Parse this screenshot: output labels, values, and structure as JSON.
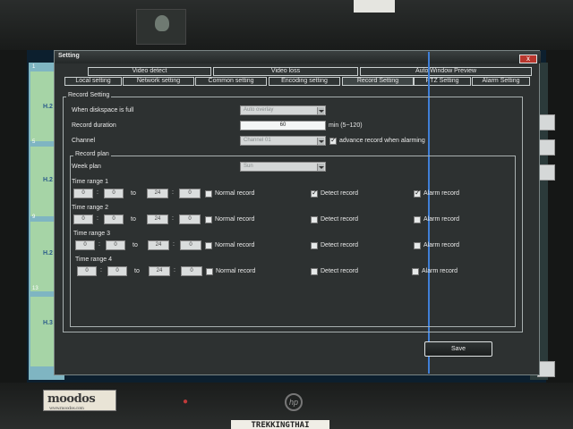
{
  "window": {
    "title": "Setting",
    "close_label": "x"
  },
  "tabs_top": [
    "Video detect",
    "Video loss",
    "Auto Window Preview"
  ],
  "tabs_bottom": [
    "Local setting",
    "Network setting",
    "Common setting",
    "Encoding setting",
    "Record Setting",
    "PTZ Setting",
    "Alarm Setting"
  ],
  "active_tab": "Record Setting",
  "record_setting": {
    "legend": "Record Setting",
    "diskfull_label": "When diskspace is full",
    "diskfull_value": "Auto overlay",
    "duration_label": "Record duration",
    "duration_value": "60",
    "duration_unit": "min (5~120)",
    "channel_label": "Channel",
    "channel_value": "Channel 01",
    "advance_label": "advance record when alarming",
    "advance_checked": true
  },
  "record_plan": {
    "legend": "Record plan",
    "week_label": "Week plan",
    "week_value": "Sun",
    "to_label": "to",
    "normal_label": "Normal record",
    "detect_label": "Detect record",
    "alarm_label": "Alarm record",
    "ranges": [
      {
        "label": "Time range 1",
        "start_h": "0",
        "start_m": "0",
        "end_h": "24",
        "end_m": "0",
        "normal": false,
        "detect": true,
        "alarm": true
      },
      {
        "label": "Time range 2",
        "start_h": "0",
        "start_m": "0",
        "end_h": "24",
        "end_m": "0",
        "normal": false,
        "detect": false,
        "alarm": false
      },
      {
        "label": "Time range 3",
        "start_h": "0",
        "start_m": "0",
        "end_h": "24",
        "end_m": "0",
        "normal": false,
        "detect": false,
        "alarm": false
      },
      {
        "label": "Time range 4",
        "start_h": "0",
        "start_m": "0",
        "end_h": "24",
        "end_m": "0",
        "normal": false,
        "detect": false,
        "alarm": false
      }
    ]
  },
  "save_label": "Save",
  "background": {
    "channel_numbers": [
      "1",
      "5",
      "9",
      "13"
    ],
    "h_labels": [
      "H.2",
      "H.2",
      "H.2",
      "H.3"
    ]
  },
  "bezel": {
    "sticker_text": "moodos",
    "sticker_sub": "www.moodos.com",
    "hp_text": "hp",
    "label_tape": "TREKKINGTHAI"
  }
}
